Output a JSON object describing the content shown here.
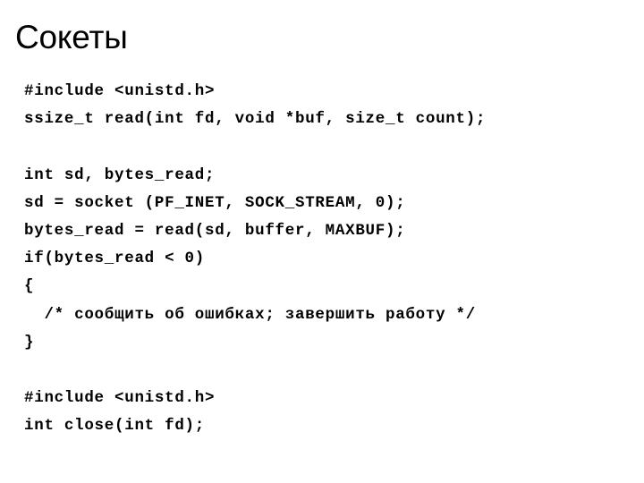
{
  "slide": {
    "title": "Сокеты",
    "background_color": "#ffffff",
    "text_color": "#000000",
    "code_lines": [
      {
        "text": "#include <unistd.h>",
        "blank": false
      },
      {
        "text": "ssize_t read(int fd, void *buf, size_t count);",
        "blank": false
      },
      {
        "text": " ",
        "blank": true
      },
      {
        "text": "int sd, bytes_read;",
        "blank": false
      },
      {
        "text": "sd = socket (PF_INET, SOCK_STREAM, 0);",
        "blank": false
      },
      {
        "text": "bytes_read = read(sd, buffer, MAXBUF);",
        "blank": false
      },
      {
        "text": "if(bytes_read < 0)",
        "blank": false
      },
      {
        "text": "{",
        "blank": false
      },
      {
        "text": "  /* сообщить об ошибках; завершить работу */",
        "blank": false
      },
      {
        "text": "}",
        "blank": false
      },
      {
        "text": " ",
        "blank": true
      },
      {
        "text": "#include <unistd.h>",
        "blank": false
      },
      {
        "text": "int close(int fd);",
        "blank": false
      }
    ]
  }
}
